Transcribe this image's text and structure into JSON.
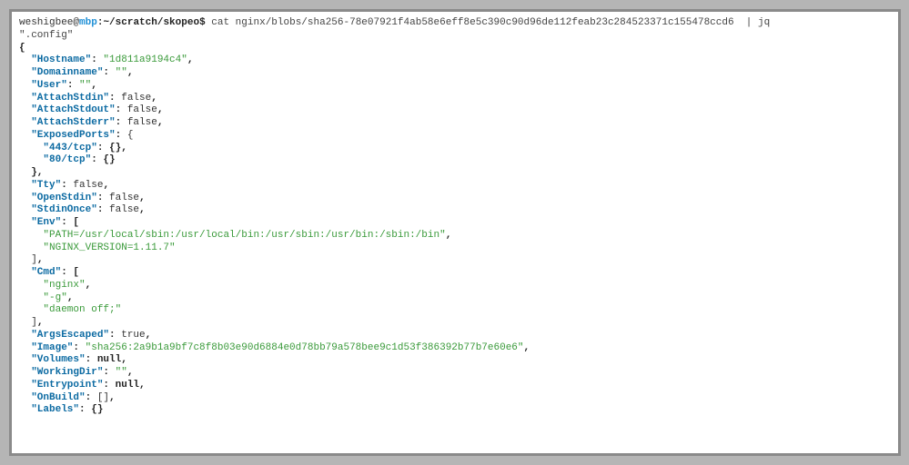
{
  "prompt": {
    "user": "weshigbee@",
    "host": "mbp",
    "sep": ":",
    "path": "~/scratch/skopeo",
    "dollar": "$"
  },
  "command": {
    "cat": "cat nginx/blobs/sha256-78e07921f4ab58e6eff8e5c390c90d96de112feab23c284523371c155478ccd6",
    "pipe": "|",
    "jq": "jq",
    "jq_arg": "\".config\""
  },
  "json": {
    "open": "{",
    "keys": {
      "Hostname": "\"Hostname\"",
      "Domainname": "\"Domainname\"",
      "User": "\"User\"",
      "AttachStdin": "\"AttachStdin\"",
      "AttachStdout": "\"AttachStdout\"",
      "AttachStderr": "\"AttachStderr\"",
      "ExposedPorts": "\"ExposedPorts\"",
      "port443": "\"443/tcp\"",
      "port80": "\"80/tcp\"",
      "Tty": "\"Tty\"",
      "OpenStdin": "\"OpenStdin\"",
      "StdinOnce": "\"StdinOnce\"",
      "Env": "\"Env\"",
      "Cmd": "\"Cmd\"",
      "ArgsEscaped": "\"ArgsEscaped\"",
      "Image": "\"Image\"",
      "Volumes": "\"Volumes\"",
      "WorkingDir": "\"WorkingDir\"",
      "Entrypoint": "\"Entrypoint\"",
      "OnBuild": "\"OnBuild\"",
      "Labels": "\"Labels\""
    },
    "vals": {
      "Hostname": "\"1d811a9194c4\"",
      "Domainname": "\"\"",
      "User": "\"\"",
      "false": "false",
      "true": "true",
      "null": "null",
      "emptyobj": "{}",
      "emptyarr": "[]",
      "openobj": "{",
      "closeobj": "}",
      "openarr": "[",
      "closearr": "]",
      "envPath": "\"PATH=/usr/local/sbin:/usr/local/bin:/usr/sbin:/usr/bin:/sbin:/bin\"",
      "envNginx": "\"NGINX_VERSION=1.11.7\"",
      "cmdNginx": "\"nginx\"",
      "cmdG": "\"-g\"",
      "cmdDaemon": "\"daemon off;\"",
      "Image": "\"sha256:2a9b1a9bf7c8f8b03e90d6884e0d78bb79a578bee9c1d53f386392b77b7e60e6\"",
      "WorkingDir": "\"\""
    },
    "punct": {
      "colon": ": ",
      "comma": ",",
      "closebrace_comma": "},"
    }
  }
}
